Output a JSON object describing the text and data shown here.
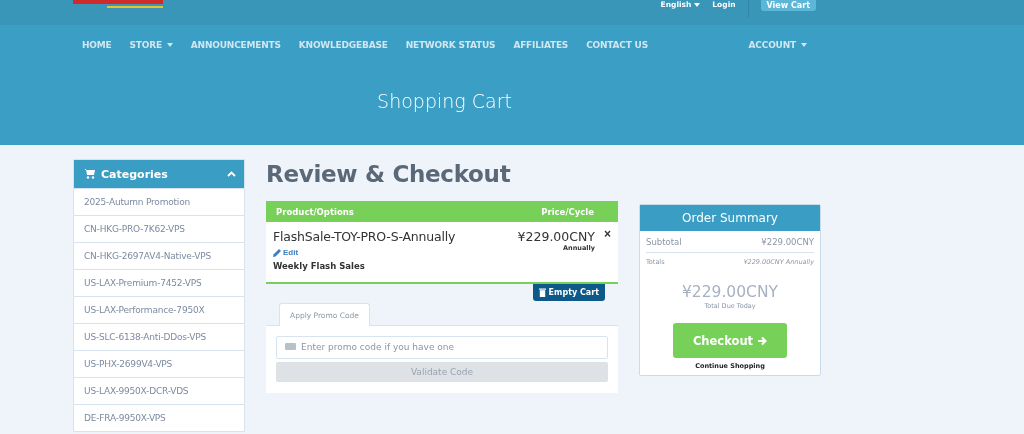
{
  "top_bar": {
    "language": "English",
    "login": "Login",
    "cart_button": "View Cart"
  },
  "nav": {
    "items": [
      {
        "label": "HOME",
        "dropdown": false
      },
      {
        "label": "STORE",
        "dropdown": true
      },
      {
        "label": "ANNOUNCEMENTS",
        "dropdown": false
      },
      {
        "label": "KNOWLEDGEBASE",
        "dropdown": false
      },
      {
        "label": "NETWORK STATUS",
        "dropdown": false
      },
      {
        "label": "AFFILIATES",
        "dropdown": false
      },
      {
        "label": "CONTACT US",
        "dropdown": false
      }
    ],
    "account": {
      "label": "ACCOUNT",
      "dropdown": true
    }
  },
  "page_title": "Shopping Cart",
  "sidebar": {
    "title": "Categories",
    "expanded": true,
    "items": [
      {
        "label": "2025-Autumn Promotion"
      },
      {
        "label": "CN-HKG-PRO-7K62-VPS"
      },
      {
        "label": "CN-HKG-2697AV4-Native-VPS"
      },
      {
        "label": "US-LAX-Premium-7452-VPS"
      },
      {
        "label": "US-LAX-Performance-7950X"
      },
      {
        "label": "US-SLC-6138-Anti-DDos-VPS"
      },
      {
        "label": "US-PHX-2699V4-VPS"
      },
      {
        "label": "US-LAX-9950X-DCR-VDS"
      },
      {
        "label": "DE-FRA-9950X-VPS"
      }
    ]
  },
  "heading": "Review & Checkout",
  "cart": {
    "columns": [
      "Product/Options",
      "Price/Cycle"
    ],
    "items": [
      {
        "name": "FlashSale-TOY-PRO-S-Annually",
        "edit": "Edit",
        "group": "Weekly Flash Sales",
        "price": "¥229.00CNY",
        "cycle": "Annually",
        "remove": "×"
      }
    ],
    "empty_button": "Empty Cart"
  },
  "promo": {
    "tabs": [
      {
        "label": "Apply Promo Code",
        "selected": true
      }
    ],
    "placeholder": "Enter promo code if you have one",
    "button": "Validate Code"
  },
  "summary": {
    "title": "Order Summary",
    "subtotal_label": "Subtotal",
    "subtotal": "¥229.00CNY",
    "totals_label": "Totals",
    "totals": "¥229.00CNY Annually",
    "total_due": "¥229.00CNY",
    "total_due_label": "Total Due Today",
    "checkout": "Checkout",
    "continue": "Continue Shopping"
  }
}
